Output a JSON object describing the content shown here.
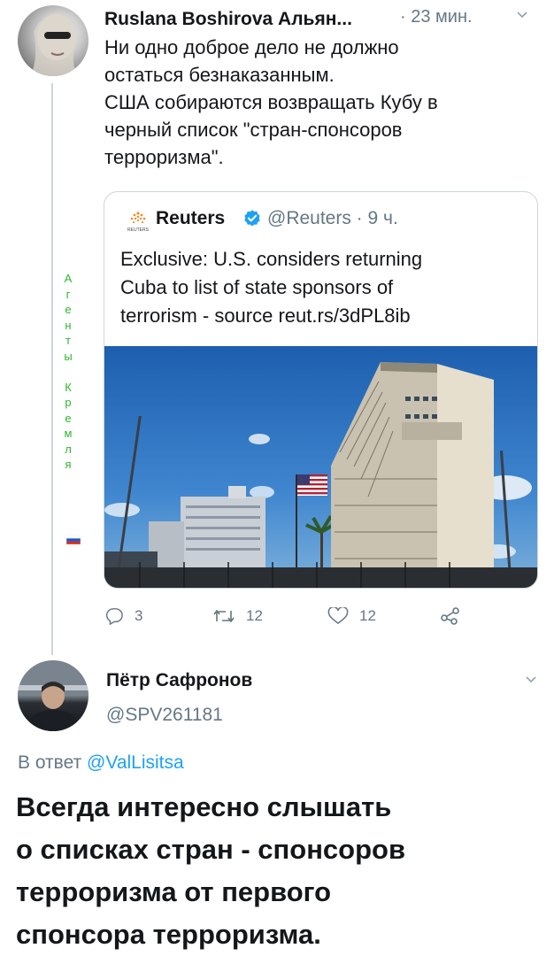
{
  "tweet": {
    "author_name": "Ruslana Boshirova Альян...",
    "time": "· 23 мин.",
    "text_lines": [
      "Ни одно доброе дело не должно",
      "остаться безнаказанным.",
      "США собираются возвращать Кубу в",
      "черный список \"стран-спонсоров",
      "терроризма\"."
    ]
  },
  "quoted": {
    "logo_caption": "REUTERS",
    "author_name": "Reuters",
    "handle_time": "@Reuters · 9 ч.",
    "text_lines": [
      "Exclusive: U.S. considers returning",
      "Cuba to list of state sponsors of",
      "terrorism - source reut.rs/3dPL8ib"
    ]
  },
  "side_caption": [
    "А",
    "г",
    "е",
    "н",
    "т",
    "ы",
    " ",
    "К",
    "р",
    "е",
    "м",
    "л",
    "я"
  ],
  "actions": {
    "replies": "3",
    "retweets": "12",
    "likes": "12"
  },
  "reply": {
    "author_name": "Пётр Сафронов",
    "handle": "@SPV261181",
    "in_reply_prefix": "В ответ ",
    "in_reply_handle": "@ValLisitsa",
    "text_lines": [
      "Всегда интересно слышать",
      "о списках стран - спонсоров",
      "терроризма от первого",
      "спонсора терроризма."
    ]
  },
  "colors": {
    "accent": "#1da1f2",
    "text": "#14171a",
    "secondary": "#657786",
    "border": "#ccd6dd",
    "caption_green": "#2fb52f"
  }
}
